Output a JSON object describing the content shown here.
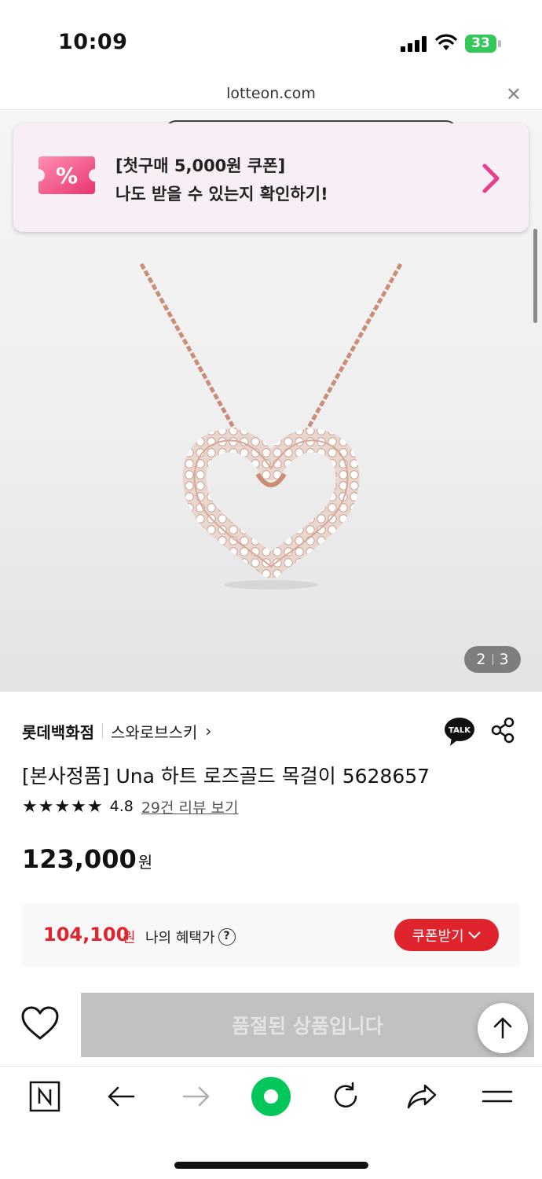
{
  "status_bar": {
    "time": "10:09",
    "battery": "33"
  },
  "url_bar": {
    "url": "lotteon.com"
  },
  "coupon_banner": {
    "line1": "[첫구매 5,000원 쿠폰]",
    "line2": "나도 받을 수 있는지 확인하기!",
    "icon": "percent-ticket-icon"
  },
  "gallery": {
    "current": "2",
    "total": "3"
  },
  "product": {
    "store": "롯데백화점",
    "brand": "스와로브스키",
    "title": "[본사정품] Una 하트 로즈골드 목걸이 5628657",
    "rating": "4.8",
    "rating_stars": 5,
    "review_link": "29건 리뷰 보기",
    "price": "123,000",
    "price_unit": "원"
  },
  "benefit": {
    "price": "104,100",
    "unit": "원",
    "label": "나의 혜택가",
    "help": "?",
    "coupon_button": "쿠폰받기"
  },
  "purchase": {
    "soldout_label": "품절된 상품입니다"
  },
  "colors": {
    "accent_red": "#e0242e",
    "coupon_pink": "#e83e8c",
    "banner_bg": "#f7eef6",
    "naver_green": "#03c75a"
  }
}
